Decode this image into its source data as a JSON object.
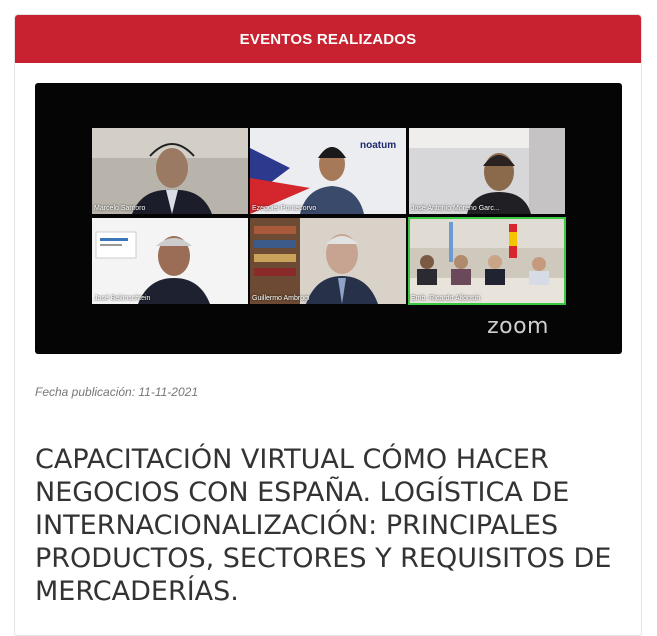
{
  "header": {
    "title": "EVENTOS REALIZADOS"
  },
  "media": {
    "participants": [
      "Marcelo Santoro",
      "Ezequiel Pontecorvo",
      "José Antonio Moreno Garc...",
      "José Bekinschtein",
      "Guillermo Ambrogi",
      "Emb. Ricardo Alfonsín"
    ],
    "tile_brand": "noatum",
    "app_logo": "zoom"
  },
  "article": {
    "date": "Fecha publicación: 11-11-2021",
    "title": "CAPACITACIÓN VIRTUAL CÓMO HACER NEGOCIOS CON ESPAÑA. LOGÍSTICA DE INTERNACIONALIZACIÓN: PRINCIPALES PRODUCTOS, SECTORES Y REQUISITOS DE MERCADERÍAS."
  },
  "colors": {
    "accent": "#c8212f",
    "active_speaker": "#38c842"
  }
}
